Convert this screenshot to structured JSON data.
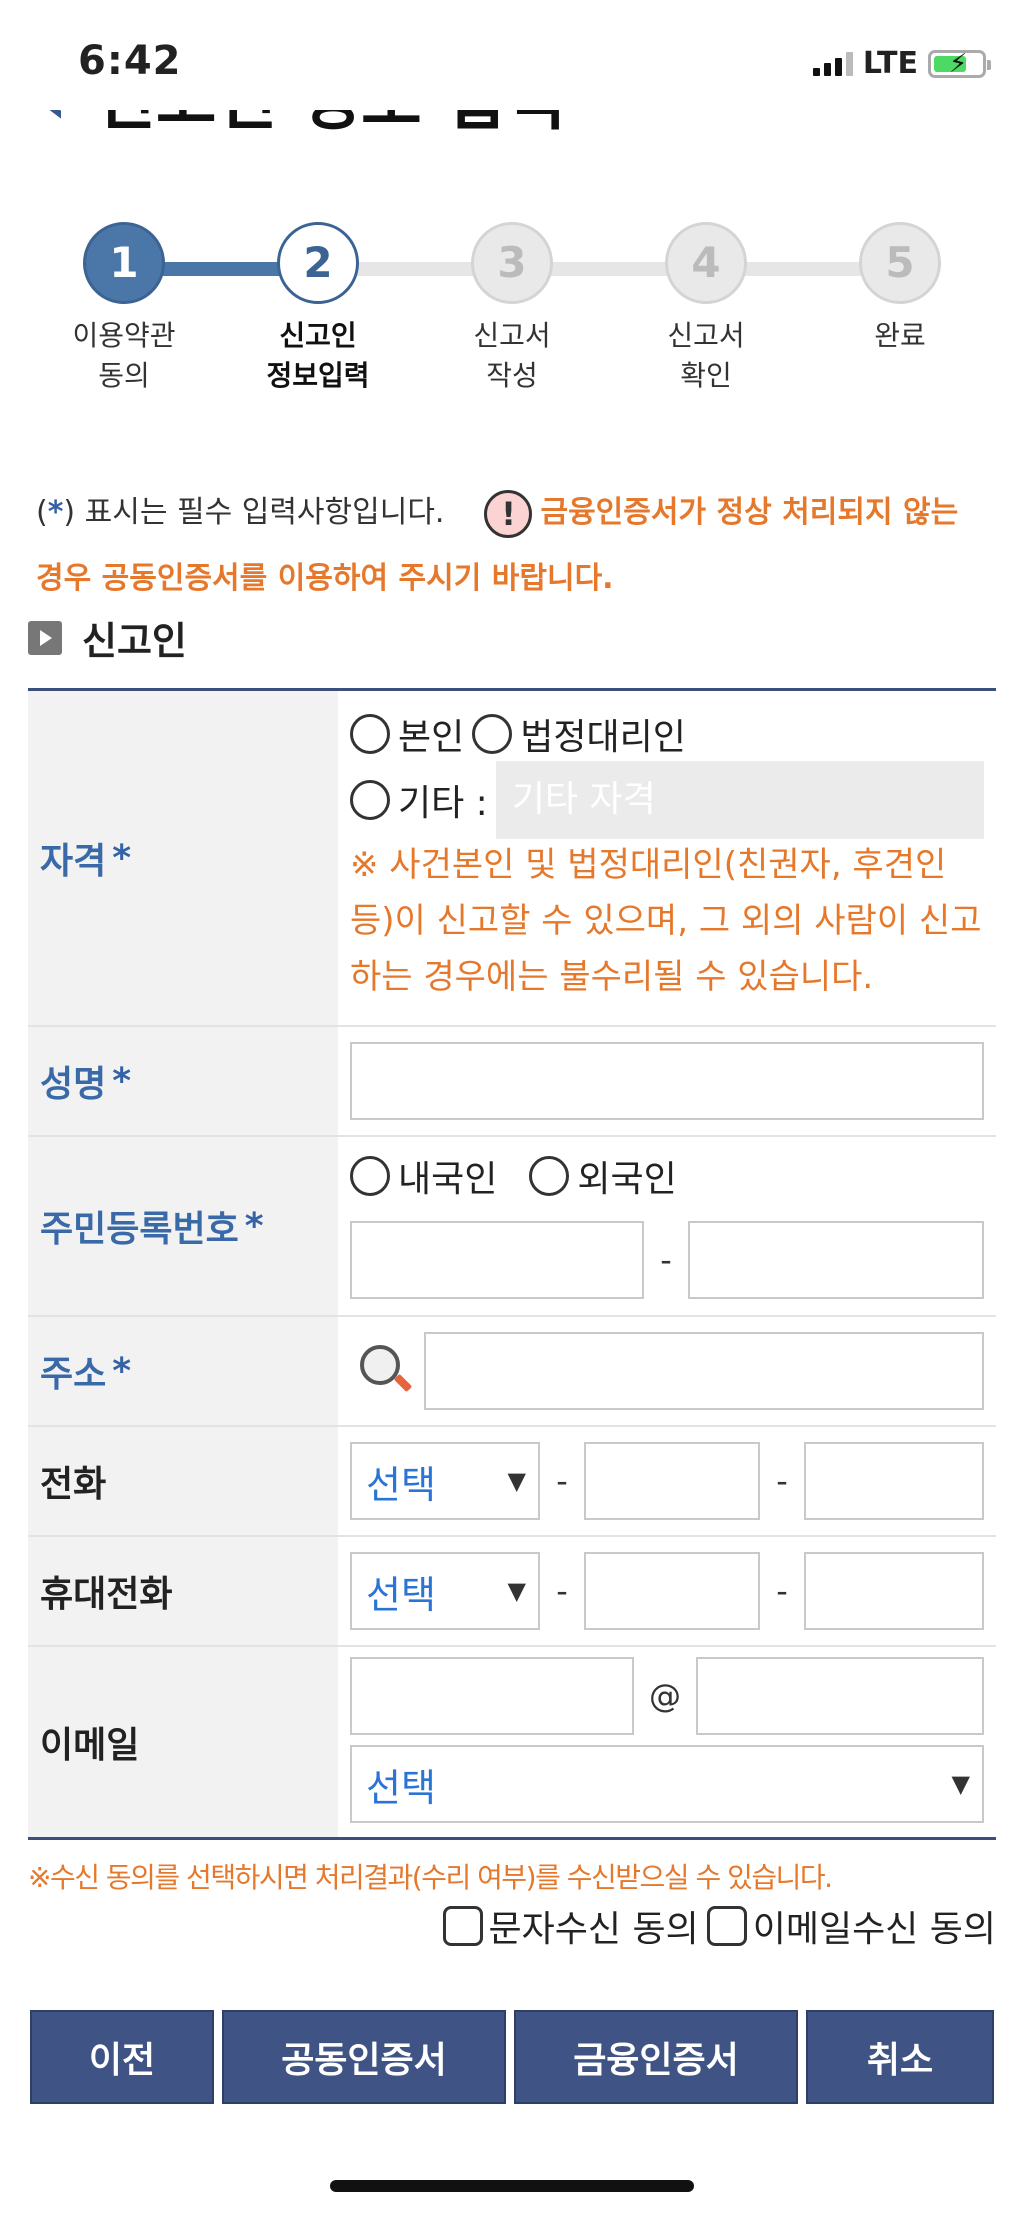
{
  "status_bar": {
    "time": "6:42",
    "network": "LTE"
  },
  "page": {
    "back_icon": "‹",
    "title": "신고인 정보 입력"
  },
  "stepper": {
    "steps": [
      {
        "num": "1",
        "line1": "이용약관",
        "line2": "동의",
        "state": "done"
      },
      {
        "num": "2",
        "line1": "신고인",
        "line2": "정보입력",
        "state": "current"
      },
      {
        "num": "3",
        "line1": "신고서",
        "line2": "작성",
        "state": "todo"
      },
      {
        "num": "4",
        "line1": "신고서",
        "line2": "확인",
        "state": "todo"
      },
      {
        "num": "5",
        "line1": "완료",
        "line2": "",
        "state": "todo"
      }
    ]
  },
  "notice": {
    "required_prefix": "(",
    "star": "*",
    "required_text": ") 표시는 필수 입력사항입니다.",
    "warning_icon": "!",
    "warning_text": "금융인증서가 정상 처리되지 않는 경우 공동인증서를 이용하여 주시기 바랍니다."
  },
  "section": {
    "title": "신고인"
  },
  "form": {
    "qualification": {
      "label": "자격",
      "star": "*",
      "option_self": "본인",
      "option_legal": "법정대리인",
      "option_other": "기타 :",
      "other_placeholder": "기타 자격",
      "note": "※ 사건본인 및 법정대리인(친권자, 후견인 등)이 신고할 수 있으며, 그 외의 사람이 신고하는 경우에는 불수리될 수 있습니다."
    },
    "name": {
      "label": "성명",
      "star": "*"
    },
    "resident_no": {
      "label": "주민등록번호",
      "star": "*",
      "option_domestic": "내국인",
      "option_foreign": "외국인",
      "separator": "-"
    },
    "address": {
      "label": "주소",
      "star": "*"
    },
    "phone": {
      "label": "전화",
      "select": "선택",
      "separator": "-"
    },
    "mobile": {
      "label": "휴대전화",
      "select": "선택",
      "separator": "-"
    },
    "email": {
      "label": "이메일",
      "at": "@",
      "select": "선택"
    },
    "caret": "▼"
  },
  "footnote": "※수신 동의를 선택하시면 처리결과(수리 여부)를 수신받으실 수 있습니다.",
  "consent": {
    "sms": "문자수신 동의",
    "email": "이메일수신 동의"
  },
  "buttons": {
    "prev": "이전",
    "joint_cert": "공동인증서",
    "finance_cert": "금융인증서",
    "cancel": "취소"
  }
}
